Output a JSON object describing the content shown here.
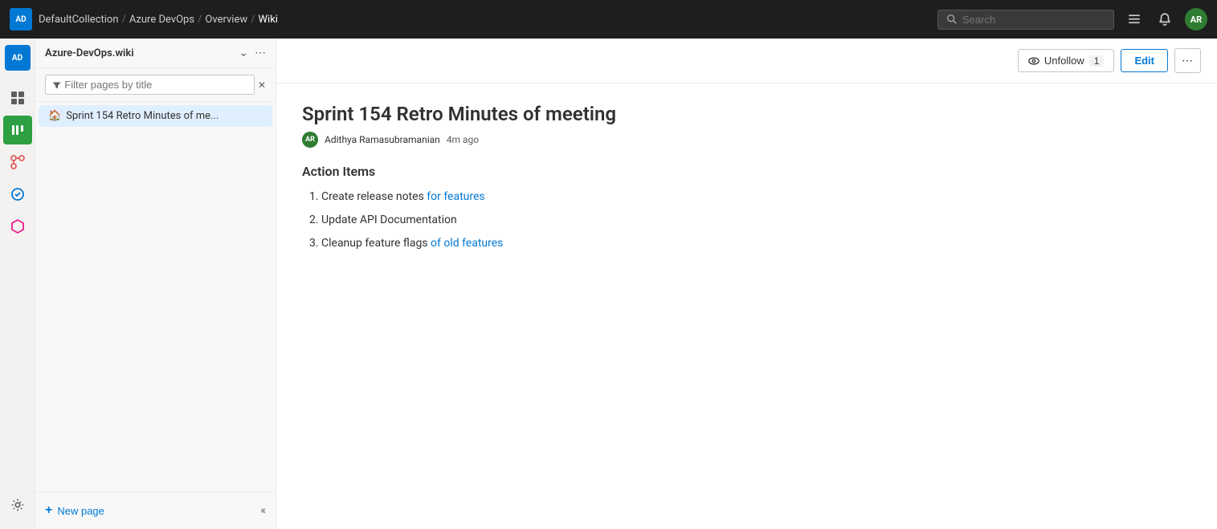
{
  "topBar": {
    "logo": "AD",
    "breadcrumbs": [
      {
        "label": "DefaultCollection",
        "href": "#"
      },
      {
        "label": "Azure DevOps",
        "href": "#"
      },
      {
        "label": "Overview",
        "href": "#"
      },
      {
        "label": "Wiki",
        "href": "#",
        "current": true
      }
    ],
    "search": {
      "placeholder": "Search"
    },
    "avatar": "AR"
  },
  "sidebar": {
    "wiki_name": "Azure-DevOps.wiki",
    "filter_placeholder": "Filter pages by title",
    "tree": [
      {
        "label": "Sprint 154 Retro Minutes of me...",
        "icon": "🏠",
        "active": true
      }
    ],
    "new_page_label": "New page"
  },
  "content": {
    "page_title": "Sprint 154 Retro Minutes of meeting",
    "author_avatar": "AR",
    "author_name": "Adithya Ramasubramanian",
    "timestamp": "4m ago",
    "unfollow_label": "Unfollow",
    "unfollow_count": "1",
    "edit_label": "Edit",
    "section_heading": "Action Items",
    "action_items": [
      {
        "text_plain": "Create release notes ",
        "text_link": "for features",
        "text_after": ""
      },
      {
        "text_plain": "Update API Documentation",
        "text_link": "",
        "text_after": ""
      },
      {
        "text_plain": "Cleanup feature flags ",
        "text_link": "of old features",
        "text_after": ""
      }
    ]
  },
  "icons": {
    "search": "🔍",
    "bell": "🔔",
    "list": "≡",
    "chevron_down": "⌄",
    "ellipsis": "⋯",
    "filter": "⊟",
    "close": "✕",
    "plus": "+",
    "chevron_double_left": "«",
    "gear": "⚙",
    "unfollow_eye": "👁"
  },
  "rail_items": [
    {
      "icon": "📋",
      "label": "Boards",
      "active": false
    },
    {
      "icon": "📊",
      "label": "Repos",
      "active": false
    },
    {
      "icon": "🔴",
      "label": "Pipelines",
      "active": false
    },
    {
      "icon": "🧪",
      "label": "Test Plans",
      "active": false
    },
    {
      "icon": "📦",
      "label": "Artifacts",
      "active": false
    }
  ]
}
